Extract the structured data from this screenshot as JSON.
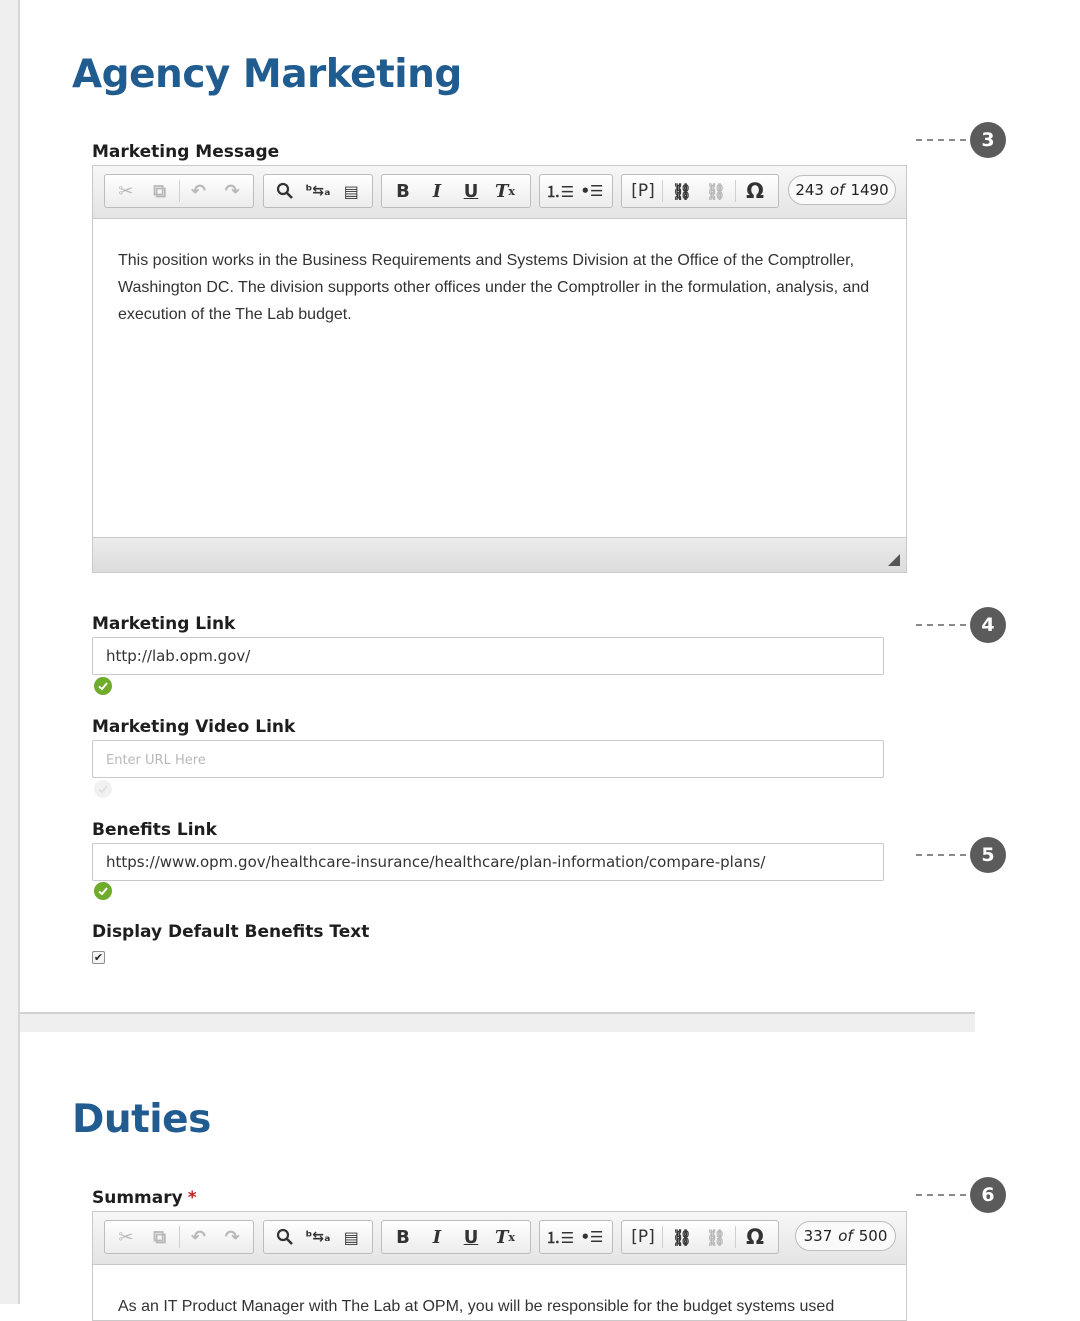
{
  "agency_marketing": {
    "title": "Agency Marketing",
    "marketing_message": {
      "label": "Marketing Message",
      "counter_current": "243",
      "counter_of": "of",
      "counter_max": "1490",
      "body": "This position works in the Business Requirements and Systems Division at the Office of the Comptroller, Washington DC. The division supports other offices under the Comptroller in the formulation, analysis, and execution of the The Lab budget."
    },
    "marketing_link": {
      "label": "Marketing Link",
      "value": "http://lab.opm.gov/"
    },
    "marketing_video_link": {
      "label": "Marketing Video Link",
      "value": "",
      "placeholder": "Enter URL Here"
    },
    "benefits_link": {
      "label": "Benefits Link",
      "value": "https://www.opm.gov/healthcare-insurance/healthcare/plan-information/compare-plans/"
    },
    "display_default_benefits": {
      "label": "Display Default Benefits Text",
      "checked": true
    }
  },
  "duties": {
    "title": "Duties",
    "summary": {
      "label": "Summary",
      "required_mark": "*",
      "counter_current": "337",
      "counter_of": "of",
      "counter_max": "500",
      "body": "As an IT Product Manager with The Lab at OPM, you will be responsible for the budget systems used"
    }
  },
  "toolbar": {
    "link_tool_label": "[P]",
    "special_char": "Ω",
    "bold": "B",
    "italic": "I",
    "underline": "U"
  },
  "callouts": [
    "3",
    "4",
    "5",
    "6"
  ],
  "colors": {
    "heading": "#205c8f",
    "success": "#6fac2c",
    "required": "#c0201e",
    "marker": "#5b5b5b"
  }
}
